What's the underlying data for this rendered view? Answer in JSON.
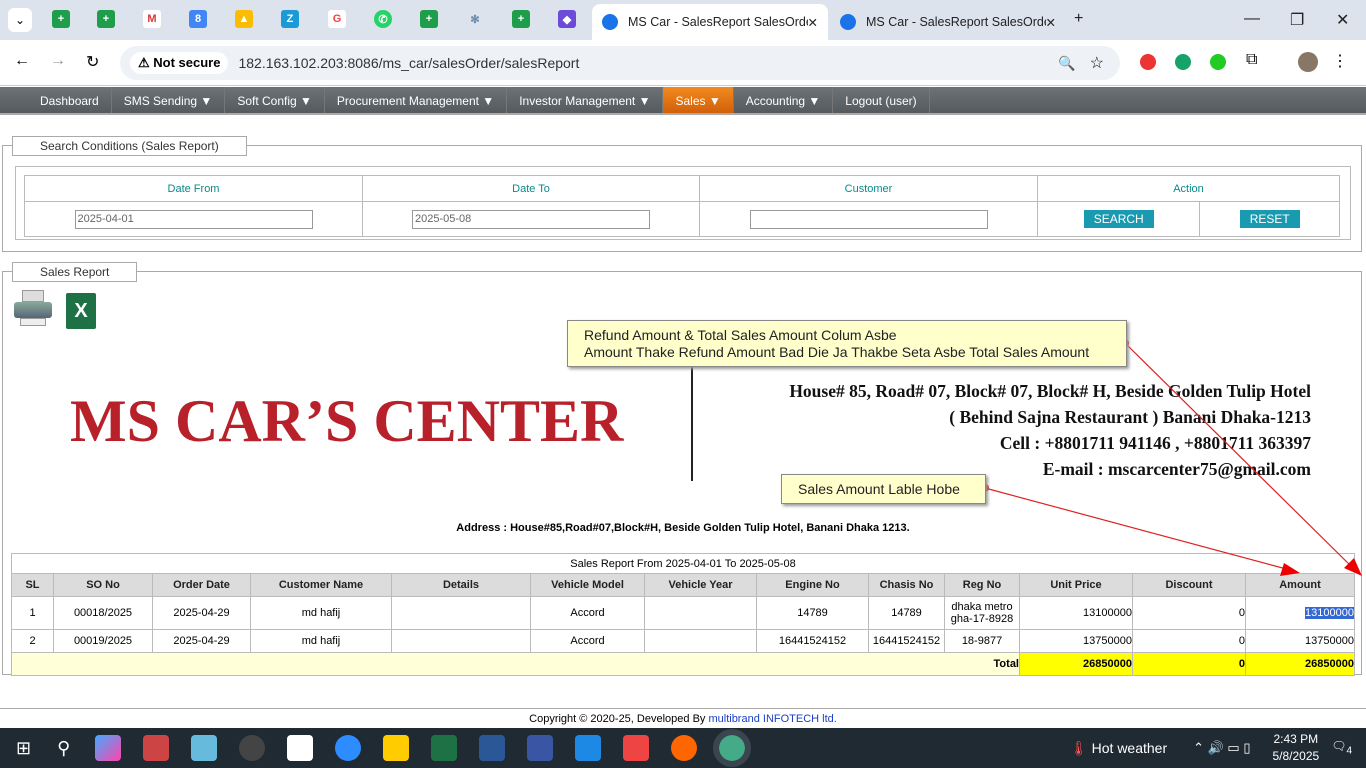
{
  "browser": {
    "tabs": [
      {
        "title": "MS Car - SalesReport SalesOrde",
        "active": true
      },
      {
        "title": "MS Car - SalesReport SalesOrde",
        "active": false
      }
    ],
    "security": "Not secure",
    "url": "182.163.102.203:8086/ms_car/salesOrder/salesReport"
  },
  "nav": [
    "Dashboard",
    "SMS Sending ▼",
    "Soft Config ▼",
    "Procurement Management ▼",
    "Investor Management ▼",
    "Sales ▼",
    "Accounting ▼",
    "Logout (user)"
  ],
  "search": {
    "legend": "Search Conditions (Sales Report)",
    "headers": [
      "Date From",
      "Date To",
      "Customer",
      "Action"
    ],
    "date_from": "2025-04-01",
    "date_to": "2025-05-08",
    "customer": "",
    "search_label": "SEARCH",
    "reset_label": "RESET"
  },
  "report": {
    "legend": "Sales Report",
    "company": "MS CAR’S CENTER",
    "contact": [
      "House# 85, Road# 07, Block# 07, Block# H, Beside Golden Tulip Hotel",
      "( Behind Sajna Restaurant ) Banani Dhaka-1213",
      "Cell : +8801711 941146 , +8801711 363397",
      "E-mail : mscarcenter75@gmail.com"
    ],
    "address": "Address : House#85,Road#07,Block#H, Beside Golden Tulip Hotel, Banani Dhaka 1213.",
    "caption": "Sales Report From 2025-04-01 To 2025-05-08",
    "columns": [
      "SL",
      "SO No",
      "Order Date",
      "Customer Name",
      "Details",
      "Vehicle Model",
      "Vehicle Year",
      "Engine No",
      "Chasis No",
      "Reg No",
      "Unit Price",
      "Discount",
      "Amount"
    ],
    "rows": [
      [
        "1",
        "00018/2025",
        "2025-04-29",
        "md hafij",
        "",
        "Accord",
        "",
        "14789",
        "14789",
        "dhaka metro gha-17-8928",
        "13100000",
        "0",
        "13100000"
      ],
      [
        "2",
        "00019/2025",
        "2025-04-29",
        "md hafij",
        "",
        "Accord",
        "",
        "16441524152",
        "16441524152",
        "18-9877",
        "13750000",
        "0",
        "13750000"
      ]
    ],
    "total_label": "Total",
    "total_unit_price": "26850000",
    "total_discount": "0",
    "total_amount": "26850000"
  },
  "annotations": {
    "note1_line1": "Refund Amount & Total Sales Amount Colum Asbe",
    "note1_line2": "Amount Thake Refund Amount Bad Die Ja Thakbe Seta Asbe Total Sales Amount",
    "note2": "Sales Amount Lable Hobe"
  },
  "footer": {
    "text": "Copyright © 2020-25, Developed By ",
    "link": "multibrand INFOTECH ltd."
  },
  "taskbar": {
    "weather": "Hot weather",
    "time": "2:43 PM",
    "date": "5/8/2025",
    "notifications": "4"
  }
}
